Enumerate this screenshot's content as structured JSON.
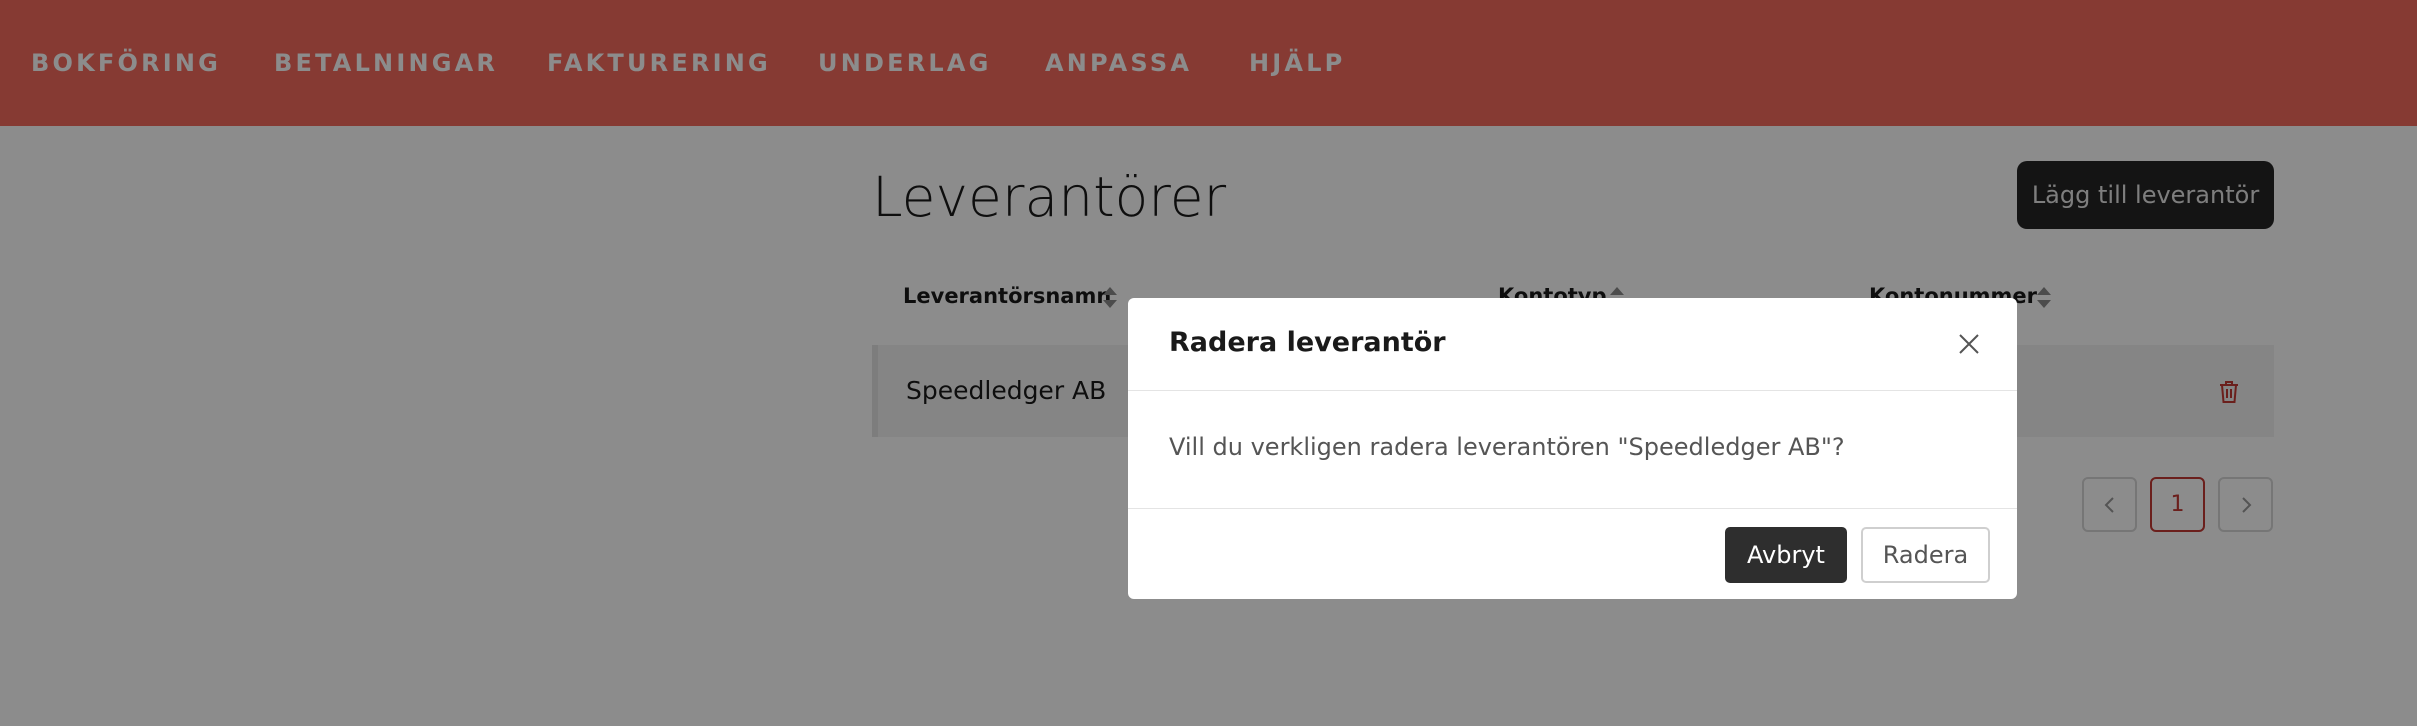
{
  "nav": {
    "items": [
      "BOKFÖRING",
      "BETALNINGAR",
      "FAKTURERING",
      "UNDERLAG",
      "ANPASSA",
      "HJÄLP"
    ]
  },
  "page": {
    "title": "Leverantörer",
    "add_button": "Lägg till leverantör"
  },
  "table": {
    "columns": [
      "Leverantörsnamn",
      "Kontotyp",
      "Kontonummer"
    ],
    "rows": [
      {
        "name": "Speedledger AB",
        "kontotyp": "",
        "kontonummer": ""
      }
    ]
  },
  "pagination": {
    "current": "1"
  },
  "modal": {
    "title": "Radera leverantör",
    "message": "Vill du verkligen radera leverantören \"Speedledger AB\"?",
    "cancel_label": "Avbryt",
    "delete_label": "Radera"
  },
  "colors": {
    "nav_bg": "#f56a5e",
    "accent_dark": "#262626",
    "danger": "#c43a33"
  },
  "icons": {
    "close": "close-icon",
    "trash": "trash-icon",
    "sort": "sort-icon",
    "prev": "chevron-left-icon",
    "next": "chevron-right-icon"
  }
}
